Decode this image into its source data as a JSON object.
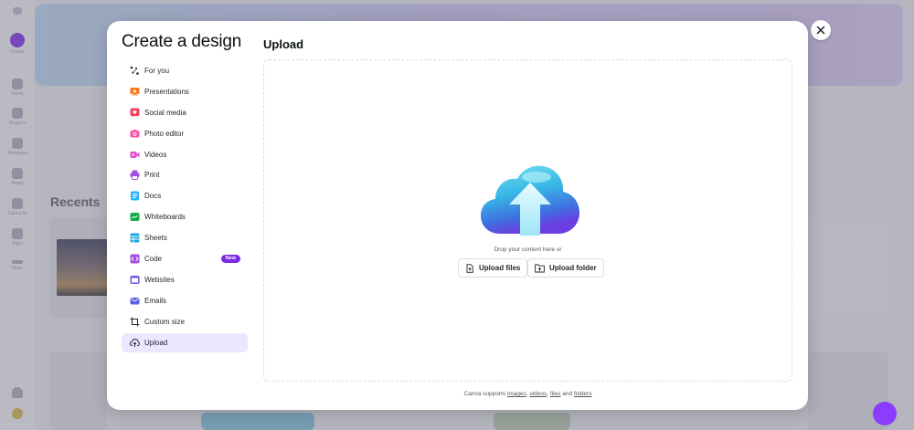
{
  "background": {
    "rail": [
      "Create",
      "Home",
      "Projects",
      "Templates",
      "Brand",
      "Canva AI",
      "Apps",
      "More"
    ],
    "recents_heading": "Recents"
  },
  "modal": {
    "title": "Create a design",
    "nav": [
      {
        "label": "For you",
        "icon": "sparkle-icon"
      },
      {
        "label": "Presentations",
        "icon": "presentation-icon"
      },
      {
        "label": "Social media",
        "icon": "heart-icon"
      },
      {
        "label": "Photo editor",
        "icon": "camera-icon"
      },
      {
        "label": "Videos",
        "icon": "video-icon"
      },
      {
        "label": "Print",
        "icon": "printer-icon"
      },
      {
        "label": "Docs",
        "icon": "doc-icon"
      },
      {
        "label": "Whiteboards",
        "icon": "whiteboard-icon"
      },
      {
        "label": "Sheets",
        "icon": "sheet-icon"
      },
      {
        "label": "Code",
        "icon": "code-icon",
        "badge": "New"
      },
      {
        "label": "Websites",
        "icon": "website-icon"
      },
      {
        "label": "Emails",
        "icon": "email-icon"
      },
      {
        "label": "Custom size",
        "icon": "crop-icon"
      },
      {
        "label": "Upload",
        "icon": "cloud-upload-icon",
        "active": true
      }
    ],
    "upload": {
      "title": "Upload",
      "drop_text": "Drop your content here or",
      "upload_files": "Upload files",
      "upload_folder": "Upload folder",
      "support_prefix": "Canva supports",
      "support_images": "images",
      "support_videos": "videos",
      "support_files": "files",
      "support_and": "and",
      "support_folders": "folders"
    }
  },
  "colors": {
    "accent": "#7d2ae8",
    "active_bg": "#ece6ff",
    "presentations": "#ff7a1a",
    "social": "#ff3b5c",
    "photo": "#ff4fa3",
    "videos": "#e64fd6",
    "print": "#a34fe0",
    "docs": "#1fb5ff",
    "whiteboards": "#15a84a",
    "sheets": "#1aa6e0",
    "websites": "#6c5ce7",
    "emails": "#5b5fe0"
  }
}
